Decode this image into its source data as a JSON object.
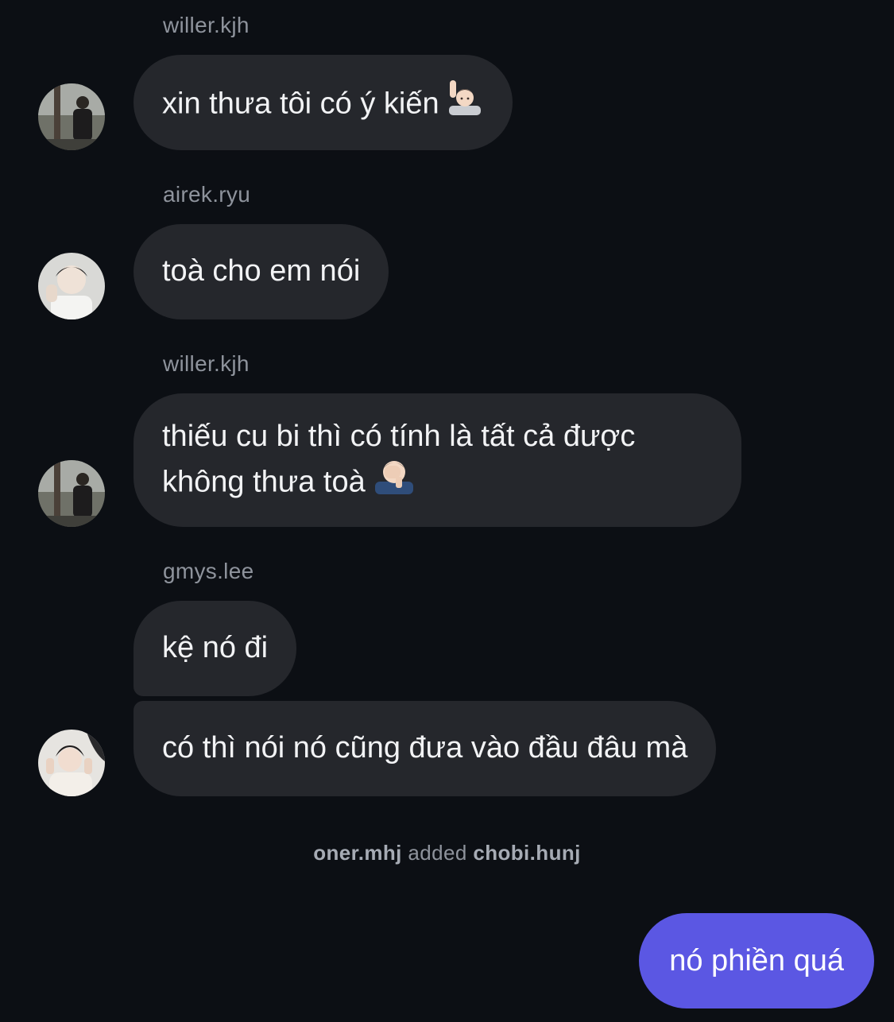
{
  "messages": [
    {
      "sender": "willer.kjh",
      "text": "xin thưa tôi có ý kiến",
      "emoji": "raising-hand-emoji"
    },
    {
      "sender": "airek.ryu",
      "text": "toà cho em nói"
    },
    {
      "sender": "willer.kjh",
      "text": "thiếu cu bi thì có tính là tất cả được không thưa toà",
      "emoji": "facepalm-emoji"
    },
    {
      "sender": "gmys.lee",
      "texts": [
        "kệ nó đi",
        "có thì nói nó cũng đưa vào đầu đâu mà"
      ]
    }
  ],
  "system_event": {
    "actor": "oner.mhj",
    "verb": "added",
    "target": "chobi.hunj"
  },
  "own_message": {
    "text": "nó phiền quá"
  },
  "colors": {
    "background": "#0c0f14",
    "incoming_bubble": "#25272c",
    "outgoing_bubble": "#5b57e3",
    "sender_name": "#8e939c"
  }
}
